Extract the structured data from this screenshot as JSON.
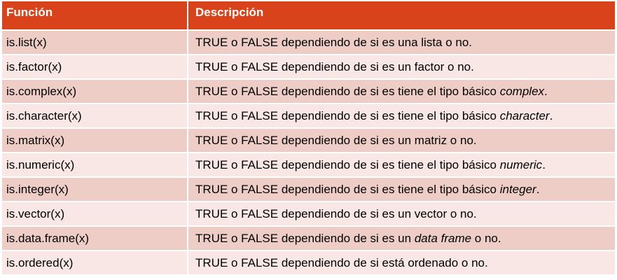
{
  "table": {
    "headers": [
      "Función",
      "Descripción"
    ],
    "rows": [
      {
        "func": "is.list(x)",
        "desc_pre": "TRUE o FALSE dependiendo de si es una lista o no.",
        "desc_em": "",
        "desc_post": ""
      },
      {
        "func": "is.factor(x)",
        "desc_pre": "TRUE o FALSE dependiendo de si es un factor o no.",
        "desc_em": "",
        "desc_post": ""
      },
      {
        "func": "is.complex(x)",
        "desc_pre": "TRUE o FALSE dependiendo de si es tiene el tipo básico ",
        "desc_em": "complex",
        "desc_post": "."
      },
      {
        "func": "is.character(x)",
        "desc_pre": "TRUE o FALSE dependiendo de si es tiene el tipo básico ",
        "desc_em": "character",
        "desc_post": "."
      },
      {
        "func": "is.matrix(x)",
        "desc_pre": "TRUE o FALSE dependiendo de si es un matriz o no.",
        "desc_em": "",
        "desc_post": ""
      },
      {
        "func": "is.numeric(x)",
        "desc_pre": "TRUE o FALSE dependiendo de si es tiene el tipo básico ",
        "desc_em": "numeric",
        "desc_post": "."
      },
      {
        "func": "is.integer(x)",
        "desc_pre": "TRUE o FALSE dependiendo de si es tiene el tipo básico ",
        "desc_em": "integer",
        "desc_post": "."
      },
      {
        "func": "is.vector(x)",
        "desc_pre": "TRUE o FALSE dependiendo de si es un vector o no.",
        "desc_em": "",
        "desc_post": ""
      },
      {
        "func": "is.data.frame(x)",
        "desc_pre": "TRUE o FALSE dependiendo de si es un ",
        "desc_em": "data frame",
        "desc_post": " o no."
      },
      {
        "func": "is.ordered(x)",
        "desc_pre": "TRUE o FALSE dependiendo de si está ordenado o no.",
        "desc_em": "",
        "desc_post": ""
      }
    ]
  },
  "colors": {
    "header_bg": "#d8431c",
    "row_odd_bg": "#efcdc7",
    "row_even_bg": "#f8e7e4"
  }
}
